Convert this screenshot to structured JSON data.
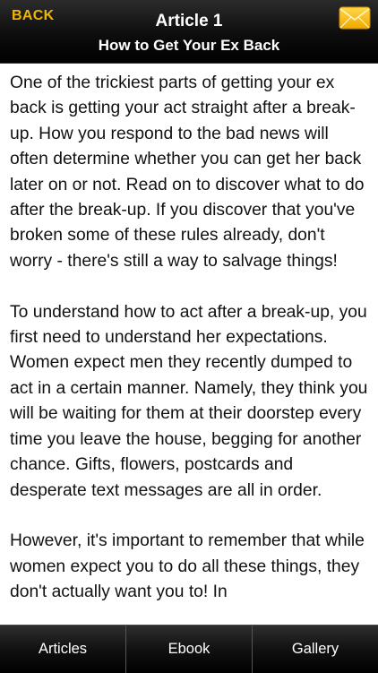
{
  "header": {
    "back_label": "BACK",
    "title": "Article 1",
    "subtitle": "How to Get Your Ex Back",
    "mail_icon": "envelope-icon",
    "accent_color": "#f0b500"
  },
  "article": {
    "body": "One of the trickiest parts of getting your ex back is getting your act straight after a break-up. How you respond to the bad news will often determine whether you can get her back later on or not. Read on to discover what to do after the break-up. If you discover that you've broken some of these rules already, don't worry - there's still a way to salvage things!\n\nTo understand how to act after a break-up, you first need to understand her expectations. Women expect men they recently dumped to act in a certain manner. Namely, they think you will be waiting for them at their doorstep every time you leave the house, begging for another chance. Gifts, flowers, postcards and desperate text messages are all in order.\n\nHowever, it's important to remember that while women expect you to do all these things, they don't actually want you to! In"
  },
  "tabs": [
    {
      "label": "Articles"
    },
    {
      "label": "Ebook"
    },
    {
      "label": "Gallery"
    }
  ]
}
